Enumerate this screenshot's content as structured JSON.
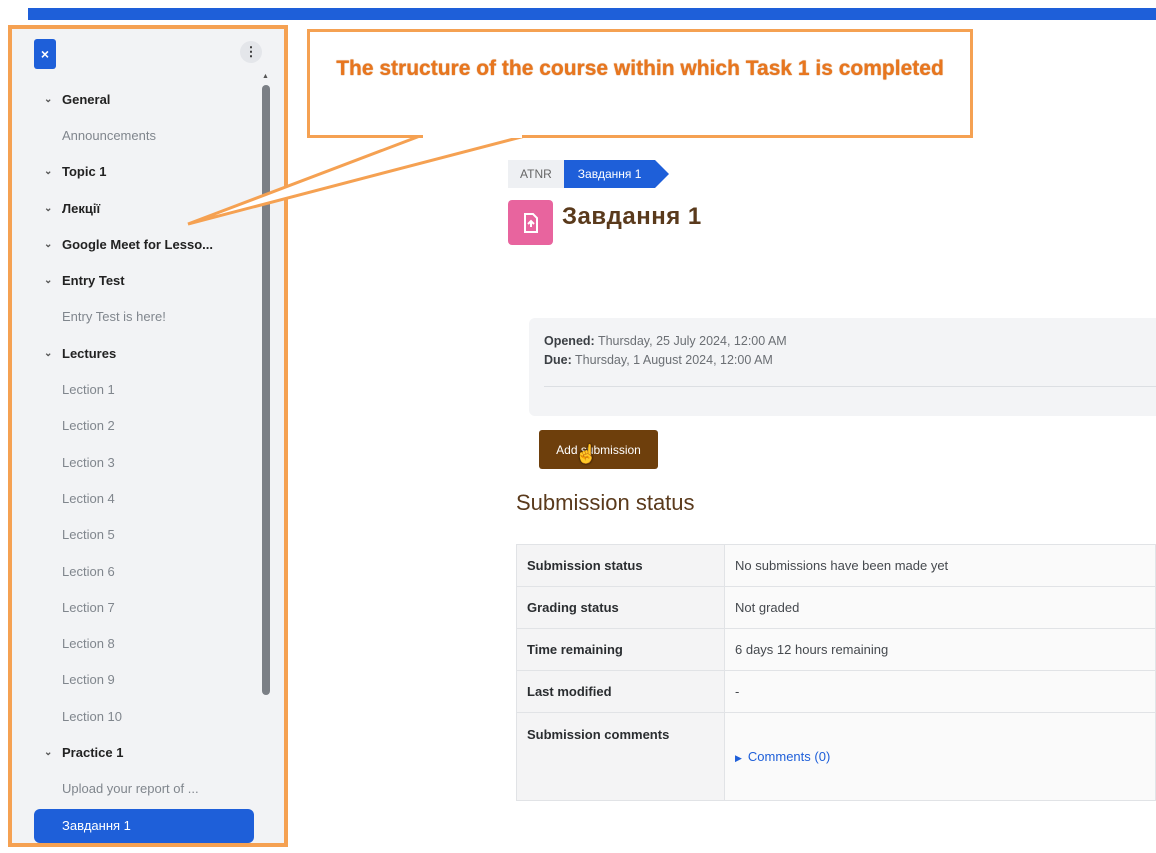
{
  "annotation": {
    "text": "The structure of the course within which Task 1 is completed"
  },
  "drawer": {
    "close_icon": "×",
    "menu_icon": "⋮",
    "items": [
      {
        "label": "General",
        "kind": "section"
      },
      {
        "label": "Announcements",
        "kind": "activity"
      },
      {
        "label": "Topic 1",
        "kind": "section"
      },
      {
        "label": "Лекції",
        "kind": "section"
      },
      {
        "label": "Google Meet for Lesso...",
        "kind": "section"
      },
      {
        "label": "Entry Test",
        "kind": "section"
      },
      {
        "label": "Entry Test is here!",
        "kind": "activity"
      },
      {
        "label": "Lectures",
        "kind": "section"
      },
      {
        "label": "Lection 1",
        "kind": "activity"
      },
      {
        "label": "Lection 2",
        "kind": "activity"
      },
      {
        "label": "Lection 3",
        "kind": "activity"
      },
      {
        "label": "Lection 4",
        "kind": "activity"
      },
      {
        "label": "Lection 5",
        "kind": "activity"
      },
      {
        "label": "Lection 6",
        "kind": "activity"
      },
      {
        "label": "Lection 7",
        "kind": "activity"
      },
      {
        "label": "Lection 8",
        "kind": "activity"
      },
      {
        "label": "Lection 9",
        "kind": "activity"
      },
      {
        "label": "Lection 10",
        "kind": "activity"
      },
      {
        "label": "Practice 1",
        "kind": "section"
      },
      {
        "label": "Upload your report of ...",
        "kind": "activity"
      },
      {
        "label": "Завдання 1",
        "kind": "active"
      }
    ]
  },
  "breadcrumb": {
    "first": "ATNR",
    "current": "Завдання 1"
  },
  "page": {
    "title": "Завдання 1",
    "icon": "assignment-icon"
  },
  "dates": {
    "opened_label": "Opened:",
    "opened_value": "Thursday, 25 July 2024, 12:00 AM",
    "due_label": "Due:",
    "due_value": "Thursday, 1 August 2024, 12:00 AM"
  },
  "actions": {
    "add_submission": "Add submission"
  },
  "submission": {
    "heading": "Submission status",
    "rows": [
      {
        "label": "Submission status",
        "value": "No submissions have been made yet"
      },
      {
        "label": "Grading status",
        "value": "Not graded"
      },
      {
        "label": "Time remaining",
        "value": "6 days 12 hours remaining"
      },
      {
        "label": "Last modified",
        "value": "-"
      }
    ],
    "comments_label": "Submission comments",
    "comments_link": "Comments (0)"
  },
  "colors": {
    "accent": "#1e5fd9",
    "annotation": "#f5a152",
    "brand_brown": "#6e3f0c",
    "icon_pink": "#e8649e"
  }
}
